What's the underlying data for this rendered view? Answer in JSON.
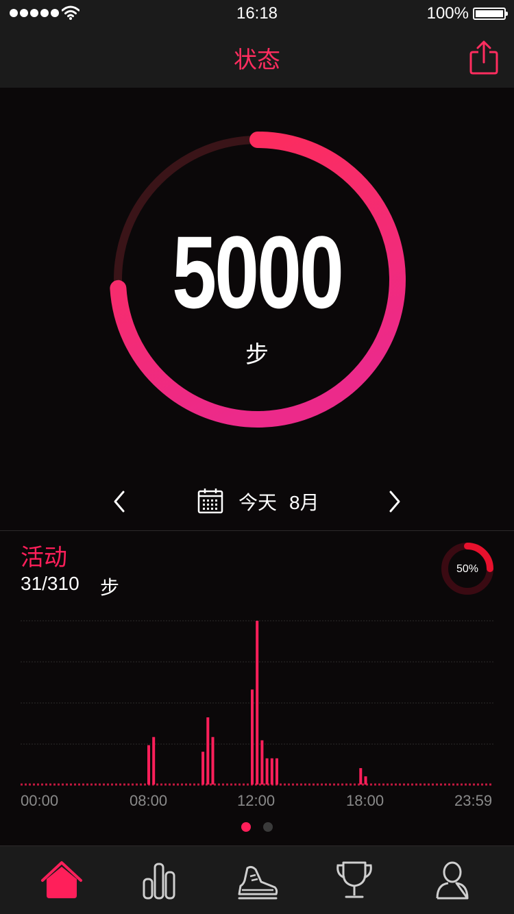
{
  "status_bar": {
    "time": "16:18",
    "battery": "100%"
  },
  "nav": {
    "title": "状态",
    "share_icon": "share-icon"
  },
  "summary": {
    "steps": "5000",
    "unit": "步",
    "progress": 0.74
  },
  "date_nav": {
    "day": "今天",
    "month": "8月"
  },
  "activity": {
    "title": "活动",
    "count": "31/310",
    "unit": "步",
    "percent_label": "50%",
    "percent": 0.5
  },
  "chart_data": {
    "type": "bar",
    "xlabel": "",
    "ylabel": "",
    "x_range": [
      "00:00",
      "23:59"
    ],
    "x_ticks": [
      "00:00",
      "08:00",
      "12:00",
      "18:00",
      "23:59"
    ],
    "series": [
      {
        "values": [
          {
            "t": "06:30",
            "v": 24
          },
          {
            "t": "06:45",
            "v": 29
          },
          {
            "t": "09:15",
            "v": 20
          },
          {
            "t": "09:30",
            "v": 41
          },
          {
            "t": "09:45",
            "v": 29
          },
          {
            "t": "11:45",
            "v": 58
          },
          {
            "t": "12:00",
            "v": 100
          },
          {
            "t": "12:15",
            "v": 27
          },
          {
            "t": "12:30",
            "v": 16
          },
          {
            "t": "12:45",
            "v": 16
          },
          {
            "t": "13:00",
            "v": 16
          },
          {
            "t": "17:15",
            "v": 10
          },
          {
            "t": "17:30",
            "v": 5
          }
        ]
      }
    ],
    "ylim": [
      0,
      100
    ],
    "grid": true
  },
  "pager": {
    "pages": 2,
    "active": 0
  },
  "colors": {
    "accent": "#ff1f5a",
    "ring_start": "#ff2d55",
    "ring_end": "#ec2a8a",
    "ring_track": "#3a1418",
    "background": "#0b0809",
    "bar_bg": "#1b1b1b"
  },
  "tabs": [
    {
      "icon": "home-icon",
      "active": true
    },
    {
      "icon": "bar-chart-icon",
      "active": false
    },
    {
      "icon": "sneaker-icon",
      "active": false
    },
    {
      "icon": "trophy-icon",
      "active": false
    },
    {
      "icon": "profile-icon",
      "active": false
    }
  ]
}
